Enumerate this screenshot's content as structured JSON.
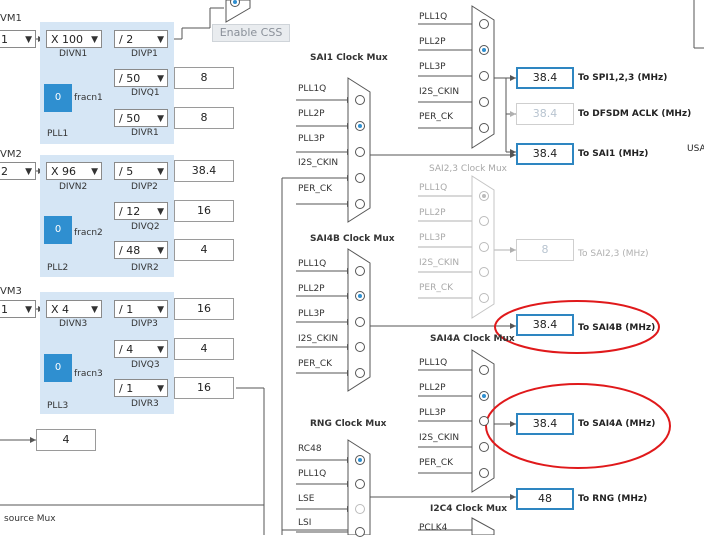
{
  "enable_css_label": "Enable CSS",
  "left_labels": {
    "divm1": "VM1",
    "divm2": "VM2",
    "divm3": "VM3",
    "divm1_val": "1",
    "divm2_val": "2",
    "divm3_val": "1",
    "bottom_value": "4",
    "source_mux": "source Mux"
  },
  "plls": [
    {
      "name": "PLL1",
      "divn": "X 100",
      "divn_label": "DIVN1",
      "fracn_value": "0",
      "fracn_label": "fracn1",
      "divp": "/ 2",
      "divp_label": "DIVP1",
      "divq": "/ 50",
      "divq_label": "DIVQ1",
      "divr": "/ 50",
      "divr_label": "DIVR1",
      "divp_out": "",
      "divq_out": "8",
      "divr_out": "8"
    },
    {
      "name": "PLL2",
      "divn": "X 96",
      "divn_label": "DIVN2",
      "fracn_value": "0",
      "fracn_label": "fracn2",
      "divp": "/ 5",
      "divp_label": "DIVP2",
      "divq": "/ 12",
      "divq_label": "DIVQ2",
      "divr": "/ 48",
      "divr_label": "DIVR2",
      "divp_out": "38.4",
      "divq_out": "16",
      "divr_out": "4"
    },
    {
      "name": "PLL3",
      "divn": "X 4",
      "divn_label": "DIVN3",
      "fracn_value": "0",
      "fracn_label": "fracn3",
      "divp": "/ 1",
      "divp_label": "DIVP3",
      "divq": "/ 4",
      "divq_label": "DIVQ3",
      "divr": "/ 1",
      "divr_label": "DIVR3",
      "divp_out": "16",
      "divq_out": "4",
      "divr_out": "16"
    }
  ],
  "muxes": {
    "sai1": {
      "title": "SAI1 Clock Mux",
      "inputs": [
        "PLL1Q",
        "PLL2P",
        "PLL3P",
        "I2S_CKIN",
        "PER_CK"
      ]
    },
    "sai4b": {
      "title": "SAI4B Clock Mux",
      "inputs": [
        "PLL1Q",
        "PLL2P",
        "PLL3P",
        "I2S_CKIN",
        "PER_CK"
      ]
    },
    "rng": {
      "title": "RNG Clock Mux",
      "inputs": [
        "RC48",
        "PLL1Q",
        "LSE",
        "LSI"
      ]
    },
    "spi": {
      "title": "",
      "inputs": [
        "PLL1Q",
        "PLL2P",
        "PLL3P",
        "I2S_CKIN",
        "PER_CK"
      ]
    },
    "sai23": {
      "title": "SAI2,3 Clock Mux",
      "inputs": [
        "PLL1Q",
        "PLL2P",
        "PLL3P",
        "I2S_CKIN",
        "PER_CK"
      ]
    },
    "sai4a": {
      "title": "SAI4A Clock Mux",
      "inputs": [
        "PLL1Q",
        "PLL2P",
        "PLL3P",
        "I2S_CKIN",
        "PER_CK"
      ]
    },
    "i2c4": {
      "title": "I2C4 Clock Mux",
      "inputs": [
        "PCLK4"
      ]
    }
  },
  "outputs": {
    "spi": {
      "value": "38.4",
      "label": "To SPI1,2,3 (MHz)"
    },
    "dfsdm": {
      "value": "38.4",
      "label": "To DFSDM ACLK (MHz)"
    },
    "sai1": {
      "value": "38.4",
      "label": "To SAI1 (MHz)"
    },
    "sai23": {
      "value": "8",
      "label": "To SAI2,3 (MHz)"
    },
    "sai4b": {
      "value": "38.4",
      "label": "To SAI4B (MHz)"
    },
    "sai4a": {
      "value": "38.4",
      "label": "To SAI4A (MHz)"
    },
    "rng": {
      "value": "48",
      "label": "To RNG (MHz)"
    }
  },
  "usa_label": "USA",
  "colors": {
    "pll_bg": "#d6e6f5",
    "accent": "#2f8fd0",
    "highlight_border": "#2e86c1",
    "annotation": "#e0191b"
  }
}
